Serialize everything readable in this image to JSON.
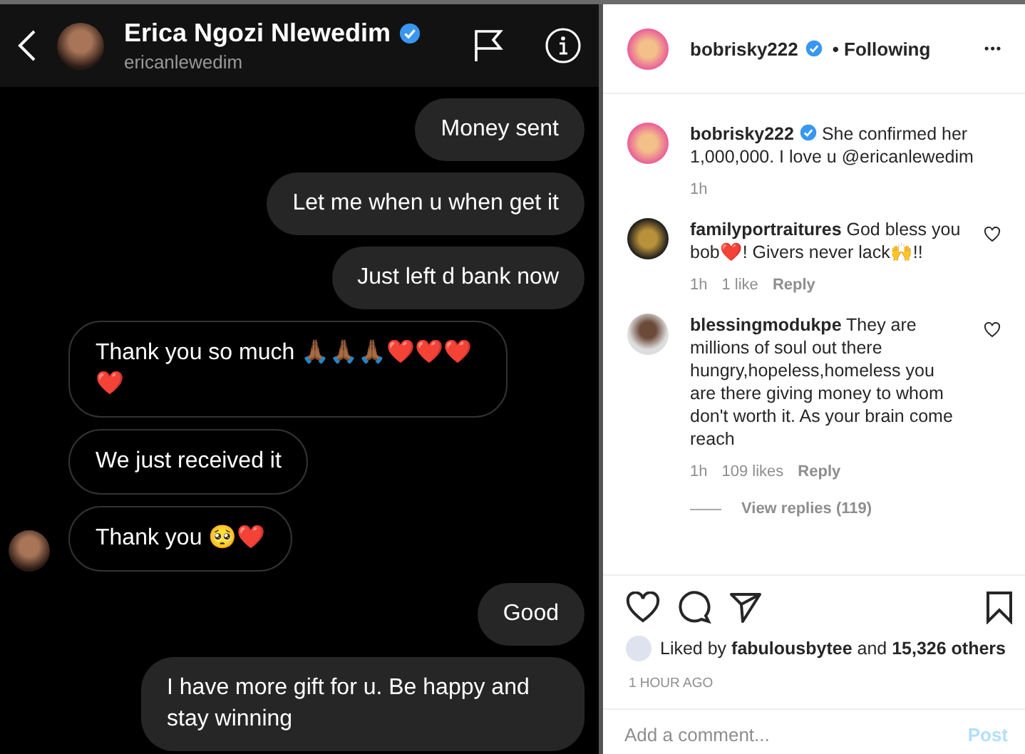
{
  "chat": {
    "contact_name": "Erica Ngozi Nlewedim",
    "verified": true,
    "contact_handle": "ericanlewedim",
    "messages": [
      {
        "kind": "sent",
        "text": "Money sent",
        "avatar": false
      },
      {
        "kind": "sent",
        "text": "Let me when u when get it",
        "avatar": false
      },
      {
        "kind": "sent",
        "text": "Just left d bank now",
        "avatar": false
      },
      {
        "kind": "received",
        "text": "Thank you so much 🙏🏾🙏🏾🙏🏾❤️❤️❤️❤️",
        "avatar": false
      },
      {
        "kind": "received",
        "text": "We just received it",
        "avatar": false
      },
      {
        "kind": "received",
        "text": "Thank you 🥺❤️",
        "avatar": true
      },
      {
        "kind": "sent",
        "text": "Good",
        "avatar": false
      },
      {
        "kind": "sent",
        "text": "I have more gift for u. Be happy and stay winning",
        "avatar": false
      }
    ]
  },
  "post": {
    "author": "bobrisky222",
    "verified": true,
    "follow_status": "• Following",
    "more": "•••",
    "comments": [
      {
        "user": "bobrisky222",
        "verified": true,
        "text": "She confirmed her 1,000,000. I love u @ericanlewedim",
        "time": "1h",
        "can_like": false
      },
      {
        "user": "familyportraitures",
        "text": "God bless you bob❤️! Givers never lack🙌!!",
        "time": "1h",
        "likes": "1 like",
        "reply": "Reply",
        "can_like": true
      },
      {
        "user": "blessingmodukpe",
        "text": "They are millions of soul out there hungry,hopeless,homeless you are there giving money to whom don't worth it. As your brain come reach",
        "time": "1h",
        "likes": "109 likes",
        "reply": "Reply",
        "view_replies": "View replies (119)",
        "can_like": true
      }
    ],
    "liked_by": "Liked by **fabulousbytee** and **15,326 others**",
    "timestamp": "1 HOUR AGO",
    "comment_placeholder": "Add a comment...",
    "post_button": "Post"
  }
}
